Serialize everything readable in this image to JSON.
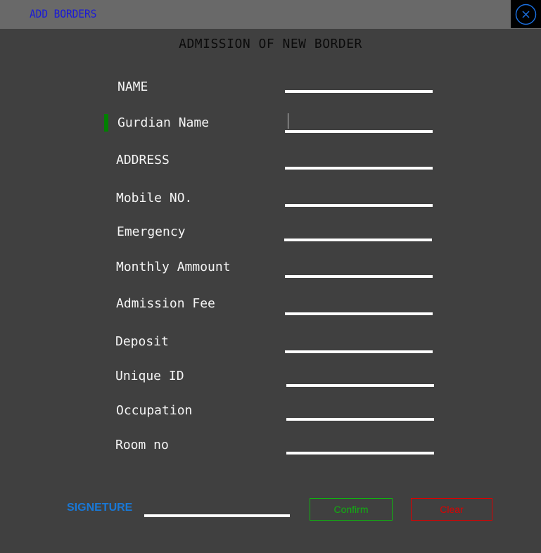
{
  "window": {
    "title": "ADD BORDERS",
    "close_icon": "close-circle-icon"
  },
  "form": {
    "title": "ADMISSION OF NEW BORDER",
    "fields": [
      {
        "label": "NAME",
        "value": ""
      },
      {
        "label": "Gurdian Name",
        "value": "",
        "focused": true
      },
      {
        "label": "ADDRESS",
        "value": ""
      },
      {
        "label": "Mobile NO.",
        "value": ""
      },
      {
        "label": "Emergency",
        "value": ""
      },
      {
        "label": "Monthly Ammount",
        "value": ""
      },
      {
        "label": "Admission Fee",
        "value": ""
      },
      {
        "label": "Deposit",
        "value": ""
      },
      {
        "label": "Unique ID",
        "value": ""
      },
      {
        "label": "Occupation",
        "value": ""
      },
      {
        "label": "Room no",
        "value": ""
      }
    ],
    "signature": {
      "label": "SIGNETURE",
      "value": ""
    }
  },
  "buttons": {
    "confirm": "Confirm",
    "clear": "Clear"
  },
  "colors": {
    "background": "#404040",
    "titlebar": "#696969",
    "title_text": "#1a1ad8",
    "signature_label": "#1978d6",
    "confirm": "#10b010",
    "clear": "#dd0000",
    "focus_indicator": "#008000"
  }
}
